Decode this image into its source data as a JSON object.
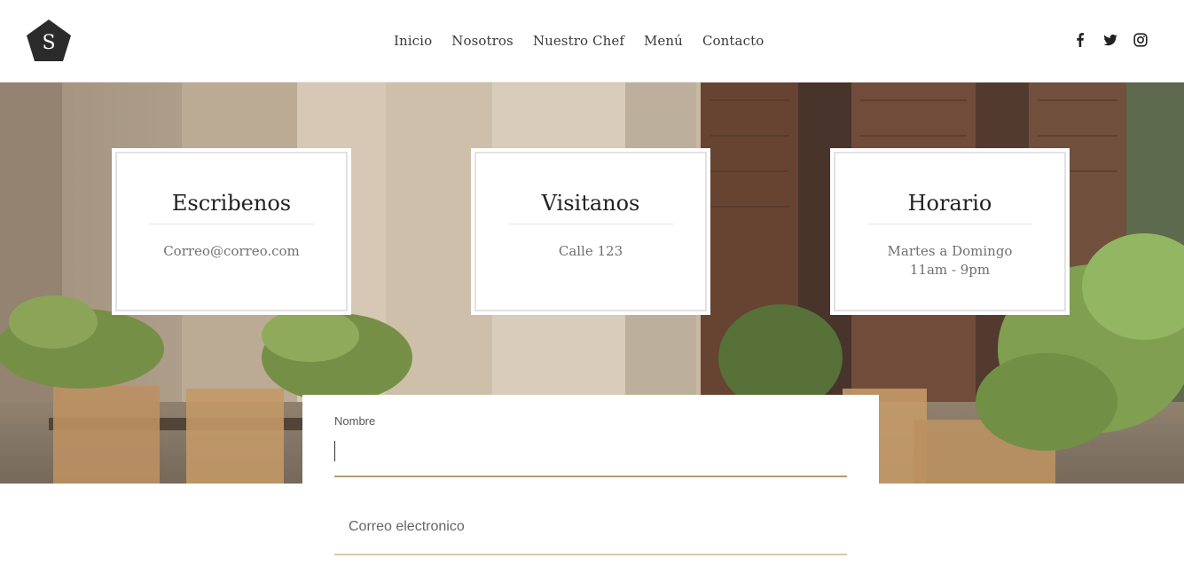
{
  "header": {
    "logo_letter": "S",
    "nav": [
      "Inicio",
      "Nosotros",
      "Nuestro Chef",
      "Menú",
      "Contacto"
    ],
    "social_icons": [
      "facebook-icon",
      "twitter-icon",
      "instagram-icon"
    ]
  },
  "cards": [
    {
      "title": "Escribenos",
      "lines": [
        "Correo@correo.com"
      ]
    },
    {
      "title": "Visitanos",
      "lines": [
        "Calle 123"
      ]
    },
    {
      "title": "Horario",
      "lines": [
        "Martes a Domingo",
        "11am - 9pm"
      ]
    }
  ],
  "form": {
    "name_label": "Nombre",
    "name_value": "",
    "email_placeholder": "Correo electronico"
  },
  "colors": {
    "accent": "#b39b6c",
    "logo_bg": "#2b2b2b"
  }
}
